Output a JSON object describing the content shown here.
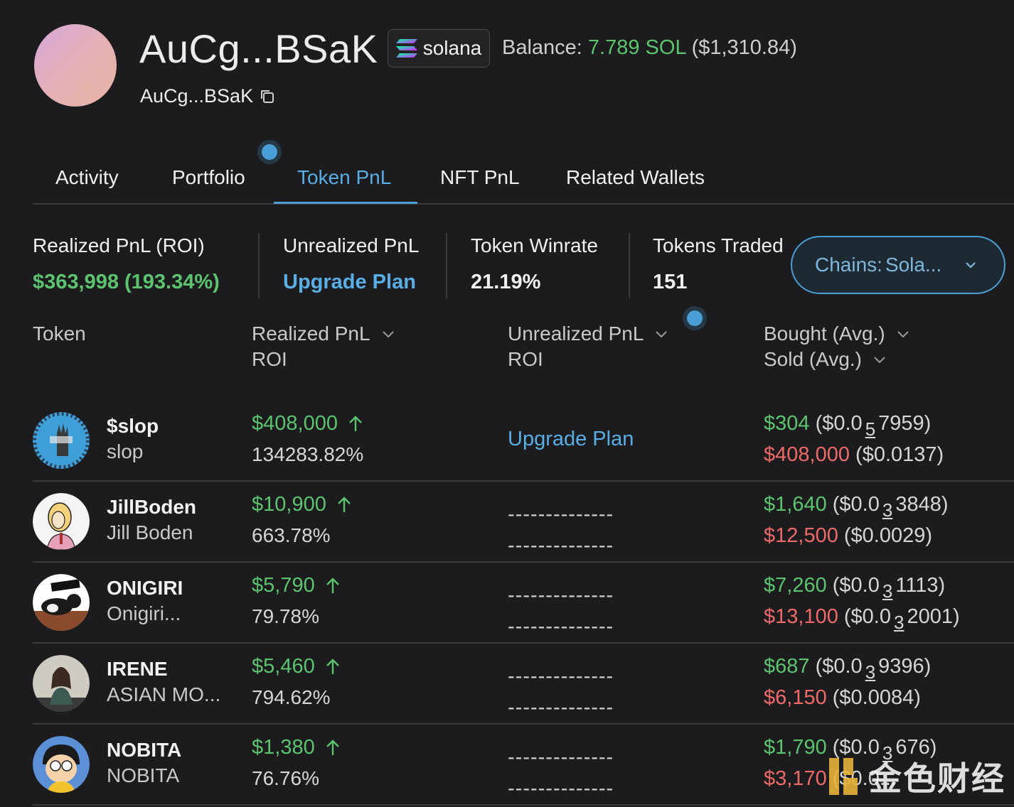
{
  "profile": {
    "title": "AuCg...BSaK",
    "address": "AuCg...BSaK",
    "chain_badge": "solana",
    "balance_label": "Balance:",
    "balance_amount": "7.789 SOL",
    "balance_usd": "($1,310.84)"
  },
  "tabs": [
    {
      "label": "Activity"
    },
    {
      "label": "Portfolio"
    },
    {
      "label": "Token PnL"
    },
    {
      "label": "NFT PnL"
    },
    {
      "label": "Related Wallets"
    }
  ],
  "active_tab": "Token PnL",
  "stats": {
    "realized": {
      "label": "Realized PnL (ROI)",
      "value": "$363,998 (193.34%)"
    },
    "unrealized": {
      "label": "Unrealized PnL",
      "value": "Upgrade Plan"
    },
    "winrate": {
      "label": "Token Winrate",
      "value": "21.19%"
    },
    "traded": {
      "label": "Tokens Traded",
      "value": "151"
    }
  },
  "chains_filter": {
    "label": "Chains:",
    "value": "Sola..."
  },
  "columns": {
    "token": "Token",
    "realized_1": "Realized PnL",
    "realized_2": "ROI",
    "unrealized_1": "Unrealized PnL",
    "unrealized_2": "ROI",
    "bought": "Bought (Avg.)",
    "sold": "Sold (Avg.)"
  },
  "rows": [
    {
      "symbol": "$slop",
      "name": "slop",
      "realized": "$408,000",
      "roi": "134283.82%",
      "unrealized_1": "Upgrade Plan",
      "unrealized_2": "",
      "bought": "$304",
      "bought_avg_a": "($0.0",
      "bought_avg_sub": "5",
      "bought_avg_b": "7959)",
      "sold": "$408,000",
      "sold_avg_a": "($0.0137)",
      "sold_avg_sub": "",
      "sold_avg_b": ""
    },
    {
      "symbol": "JillBoden",
      "name": "Jill Boden",
      "realized": "$10,900",
      "roi": "663.78%",
      "unrealized_1": "--------------",
      "unrealized_2": "--------------",
      "bought": "$1,640",
      "bought_avg_a": "($0.0",
      "bought_avg_sub": "3",
      "bought_avg_b": "3848)",
      "sold": "$12,500",
      "sold_avg_a": "($0.0029)",
      "sold_avg_sub": "",
      "sold_avg_b": ""
    },
    {
      "symbol": "ONIGIRI",
      "name": "Onigiri...",
      "realized": "$5,790",
      "roi": "79.78%",
      "unrealized_1": "--------------",
      "unrealized_2": "--------------",
      "bought": "$7,260",
      "bought_avg_a": "($0.0",
      "bought_avg_sub": "3",
      "bought_avg_b": "1113)",
      "sold": "$13,100",
      "sold_avg_a": "($0.0",
      "sold_avg_sub": "3",
      "sold_avg_b": "2001)"
    },
    {
      "symbol": "IRENE",
      "name": "ASIAN MO...",
      "realized": "$5,460",
      "roi": "794.62%",
      "unrealized_1": "--------------",
      "unrealized_2": "--------------",
      "bought": "$687",
      "bought_avg_a": "($0.0",
      "bought_avg_sub": "3",
      "bought_avg_b": "9396)",
      "sold": "$6,150",
      "sold_avg_a": "($0.0084)",
      "sold_avg_sub": "",
      "sold_avg_b": ""
    },
    {
      "symbol": "NOBITA",
      "name": "NOBITA",
      "realized": "$1,380",
      "roi": "76.76%",
      "unrealized_1": "--------------",
      "unrealized_2": "--------------",
      "bought": "$1,790",
      "bought_avg_a": "($0.0",
      "bought_avg_sub": "3",
      "bought_avg_b": "676)",
      "sold": "$3,170",
      "sold_avg_a": "($0.0...",
      "sold_avg_sub": "",
      "sold_avg_b": ""
    }
  ],
  "watermark": "金色财经",
  "colors": {
    "positive": "#5cc46f",
    "negative": "#ee6a6a",
    "accent": "#4a9fd6"
  }
}
